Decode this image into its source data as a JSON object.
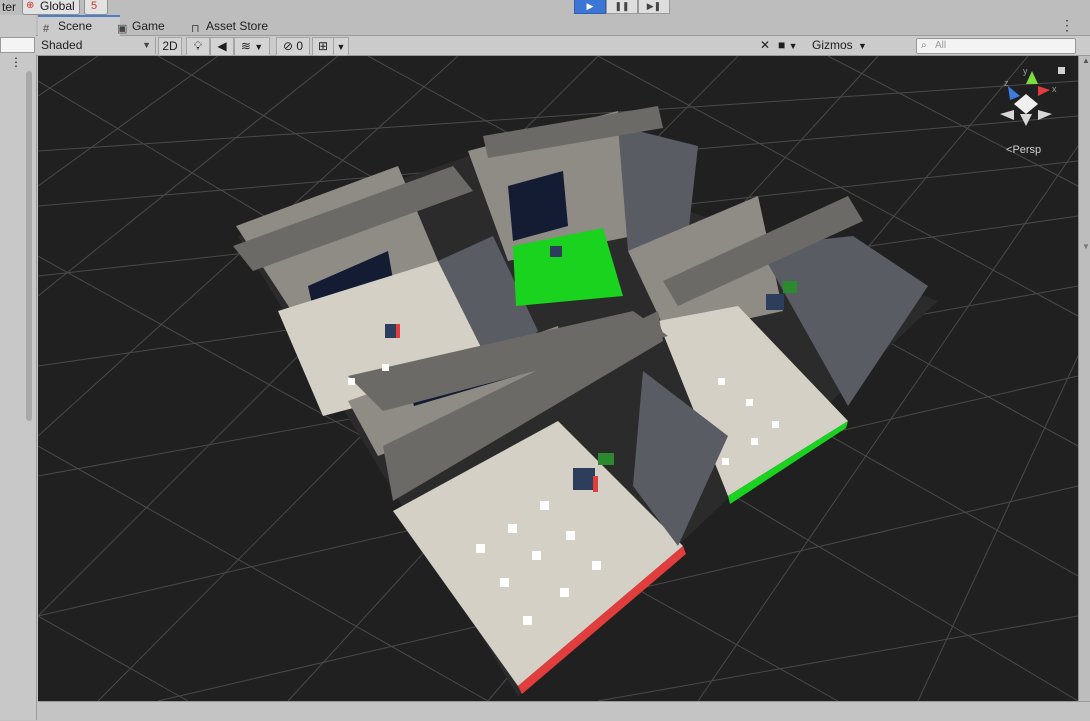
{
  "topbar": {
    "left_cut_label": "ter",
    "global_label": "Global",
    "undo_label": "5"
  },
  "playmode": {
    "play": "▶",
    "pause": "❚❚",
    "step": "▶❚"
  },
  "tabs": [
    {
      "label": "Scene",
      "icon": "grid-icon",
      "active": true
    },
    {
      "label": "Game",
      "icon": "gamepad-icon",
      "active": false
    },
    {
      "label": "Asset Store",
      "icon": "bag-icon",
      "active": false
    }
  ],
  "toolbar": {
    "shading_mode": "Shaded",
    "mode_2d": "2D",
    "hidden_count": "0",
    "gizmos_label": "Gizmos",
    "search_placeholder": "All"
  },
  "scene_gizmo": {
    "projection_label": "Persp",
    "axes": {
      "x": "x",
      "y": "y",
      "z": "z"
    },
    "colors": {
      "x": "#e23d3d",
      "y": "#7cdc3c",
      "z": "#3d7de2"
    }
  },
  "scene": {
    "background_color": "#202020",
    "grid_color": "#4a4a4a",
    "highlight_floor_color": "#19d31e"
  }
}
